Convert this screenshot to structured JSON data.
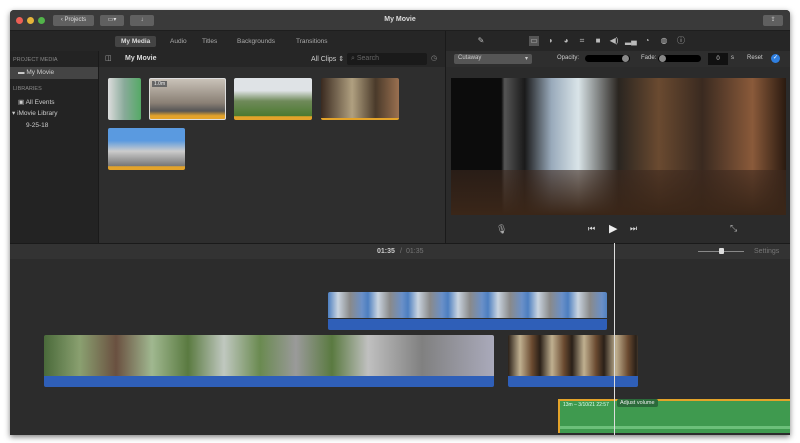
{
  "window": {
    "title": "My Movie",
    "projects_label": "Projects"
  },
  "tabs": [
    {
      "label": "My Media",
      "active": true
    },
    {
      "label": "Audio"
    },
    {
      "label": "Titles"
    },
    {
      "label": "Backgrounds"
    },
    {
      "label": "Transitions"
    }
  ],
  "sidebar": {
    "project_media_header": "PROJECT MEDIA",
    "project_item": "My Movie",
    "libraries_header": "LIBRARIES",
    "all_events": "All Events",
    "library": "iMovie Library",
    "event": "9-25-18"
  },
  "browser": {
    "title": "My Movie",
    "filter": "All Clips",
    "search_placeholder": "Search",
    "badge": "1.0m"
  },
  "viewer": {
    "blend_mode": "Cutaway",
    "opacity_label": "Opacity:",
    "fade_label": "Fade:",
    "fade_value": "0",
    "fade_unit": "s",
    "reset_label": "Reset",
    "toolbar_icons": [
      "magic-wand",
      "cutaway",
      "color-balance",
      "color-correction",
      "crop",
      "stabilization",
      "volume",
      "noise-reduction",
      "speed",
      "filter",
      "info"
    ]
  },
  "timeline": {
    "current_time": "01:35",
    "total_time": "01:35",
    "settings_label": "Settings",
    "audio_clip_label": "13m – 3/10/21 22:57",
    "tooltip": "Adjust volume"
  },
  "colors": {
    "audio_track": "#3f9a4f",
    "clip_audio": "#2f5fb8",
    "selection": "#e3a32a",
    "accent": "#2f7fe0"
  }
}
